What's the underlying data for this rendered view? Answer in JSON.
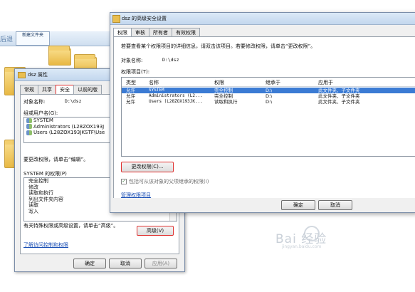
{
  "explorer": {
    "back_text": "后退",
    "tab_label": "新建文件夹"
  },
  "props_dialog": {
    "title": "dsz 属性",
    "tabs": [
      "常规",
      "共享",
      "安全",
      "以前的版"
    ],
    "object_label": "对象名称:",
    "object_value": "D:\\dsz",
    "group_label": "组或用户名(G):",
    "users": [
      "SYSTEM",
      "Administrators (L28ZOX193J",
      "Users (L28ZOX193JKSTF\\Use"
    ],
    "change_hint": "要更改权限，请单击“编辑”。",
    "perm_label": "SYSTEM 的权限(P)",
    "permissions": [
      "完全控制",
      "修改",
      "读取和执行",
      "列出文件夹内容",
      "读取",
      "写入"
    ],
    "special_hint": "有关特殊权限或高级设置，请单击“高级”。",
    "advanced_button": "高级(V)",
    "learn_link": "了解访问控制和权限",
    "ok": "确定",
    "cancel": "取消",
    "apply": "应用(A)"
  },
  "adv_dialog": {
    "title": "dsz 的高级安全设置",
    "tabs": [
      "权限",
      "审核",
      "所有者",
      "有效权限"
    ],
    "info": "若要查看某个权限项目的详细信息，请双击该项目。若要修改权限，请单击“更改权限”。",
    "object_label": "对象名称:",
    "object_value": "D:\\dsz",
    "entries_label": "权限项目(T):",
    "columns": [
      "类型",
      "名称",
      "权限",
      "继承于",
      "应用于"
    ],
    "rows": [
      {
        "type": "允许",
        "name": "SYSTEM",
        "perm": "完全控制",
        "inherit": "D:\\",
        "apply": "此文件夹、子文件夹"
      },
      {
        "type": "允许",
        "name": "Administrators (L2...",
        "perm": "完全控制",
        "inherit": "D:\\",
        "apply": "此文件夹、子文件夹"
      },
      {
        "type": "允许",
        "name": "Users (L28ZOX193JK...",
        "perm": "读取和执行",
        "inherit": "D:\\",
        "apply": "此文件夹、子文件夹"
      }
    ],
    "change_button": "更改权限(C)...",
    "inherit_check": "包括可从该对象的父项继承的权限(I)",
    "manage_link": "管理权限项目",
    "ok": "确定",
    "cancel": "取消"
  },
  "watermark": {
    "main": "Bai 经验",
    "sub": "jingyan.baidu.com"
  },
  "colors": {
    "highlight_border": "#e0302f",
    "selection": "#3b7bd4",
    "link": "#1a4fb5"
  }
}
